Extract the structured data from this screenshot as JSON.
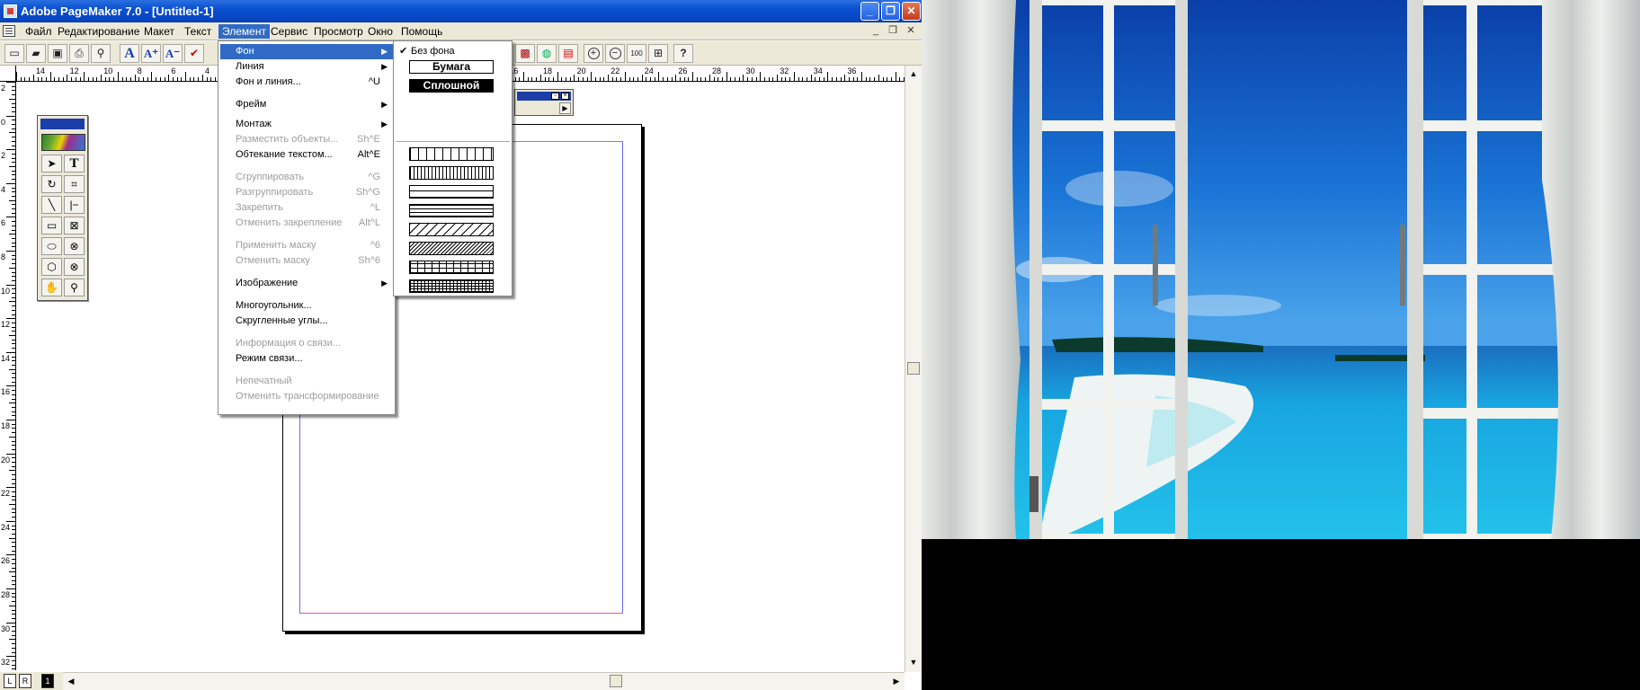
{
  "window": {
    "title": "Adobe PageMaker 7.0 - [Untitled-1]",
    "minimize": "_",
    "restore": "❐",
    "close": "✕"
  },
  "menubar": {
    "items": [
      "Файл",
      "Редактирование",
      "Макет",
      "Текст",
      "Элемент",
      "Сервис",
      "Просмотр",
      "Окно",
      "Помощь"
    ],
    "active": "Элемент",
    "mdi_minimize": "_",
    "mdi_restore": "❐",
    "mdi_close": "✕"
  },
  "toolbar": {
    "icons": [
      "new-document",
      "open",
      "save",
      "print",
      "find",
      "text-a",
      "text-a-plus",
      "text-a-minus",
      "spell-check"
    ],
    "right_icons": [
      "image",
      "globe",
      "pdf",
      "zoom-in",
      "zoom-out",
      "zoom-100",
      "fit",
      "help"
    ],
    "zoom_label": "100",
    "help_label": "?"
  },
  "ruler": {
    "h_labels": [
      "14",
      "12",
      "10",
      "8",
      "6",
      "4",
      "",
      "",
      "",
      "",
      "",
      "",
      "",
      "",
      "16",
      "18",
      "20",
      "22",
      "24",
      "26",
      "28",
      "30",
      "32",
      "34",
      "36"
    ],
    "v_labels": [
      "2",
      "0",
      "2",
      "4",
      "6",
      "8",
      "10",
      "12",
      "14",
      "16",
      "18",
      "20",
      "22",
      "24",
      "26",
      "28",
      "30",
      "32"
    ]
  },
  "page_tabs": {
    "left": "L",
    "right": "R",
    "current": "1"
  },
  "element_menu": {
    "items": [
      {
        "label": "Фон",
        "shortcut": "",
        "submenu": true,
        "state": "highlighted"
      },
      {
        "label": "Линия",
        "shortcut": "",
        "submenu": true,
        "state": "normal"
      },
      {
        "label": "Фон и линия...",
        "shortcut": "^U",
        "submenu": false,
        "state": "normal"
      },
      {
        "label": "Фрейм",
        "shortcut": "",
        "submenu": true,
        "state": "normal"
      },
      {
        "label": "Монтаж",
        "shortcut": "",
        "submenu": true,
        "state": "normal"
      },
      {
        "label": "Разместить объекты...",
        "shortcut": "Sh^E",
        "submenu": false,
        "state": "disabled"
      },
      {
        "label": "Обтекание текстом...",
        "shortcut": "Alt^E",
        "submenu": false,
        "state": "normal"
      },
      {
        "label": "Сгруппировать",
        "shortcut": "^G",
        "submenu": false,
        "state": "disabled"
      },
      {
        "label": "Разгруппировать",
        "shortcut": "Sh^G",
        "submenu": false,
        "state": "disabled"
      },
      {
        "label": "Закрепить",
        "shortcut": "^L",
        "submenu": false,
        "state": "disabled"
      },
      {
        "label": "Отменить закрепление",
        "shortcut": "Alt^L",
        "submenu": false,
        "state": "disabled"
      },
      {
        "label": "Применить маску",
        "shortcut": "^6",
        "submenu": false,
        "state": "disabled"
      },
      {
        "label": "Отменить маску",
        "shortcut": "Sh^6",
        "submenu": false,
        "state": "disabled"
      },
      {
        "label": "Изображение",
        "shortcut": "",
        "submenu": true,
        "state": "normal"
      },
      {
        "label": "Многоугольник...",
        "shortcut": "",
        "submenu": false,
        "state": "normal"
      },
      {
        "label": "Скругленные углы...",
        "shortcut": "",
        "submenu": false,
        "state": "normal"
      },
      {
        "label": "Информация о связи...",
        "shortcut": "",
        "submenu": false,
        "state": "disabled"
      },
      {
        "label": "Режим связи...",
        "shortcut": "",
        "submenu": false,
        "state": "normal"
      },
      {
        "label": "Непечатный",
        "shortcut": "",
        "submenu": false,
        "state": "disabled"
      },
      {
        "label": "Отменить трансформирование",
        "shortcut": "",
        "submenu": false,
        "state": "disabled"
      }
    ]
  },
  "background_submenu": {
    "none_label": "Без фона",
    "none_checked": true,
    "paper_label": "Бумага",
    "solid_label": "Сплошной",
    "patterns": [
      "vertical-wide",
      "vertical-dense",
      "horizontal-wide",
      "horizontal-dense",
      "diagonal-wide",
      "diagonal-dense",
      "grid",
      "grid-dense"
    ]
  },
  "colors": {
    "title_bar": "#0a4fd0",
    "menu_highlight": "#316ac5",
    "margin_top_bottom": "#e050c8",
    "margin_sides": "#6a6ae8",
    "chrome": "#ece9d8"
  },
  "wallpaper": {
    "subject": "open-window-beach-view"
  }
}
